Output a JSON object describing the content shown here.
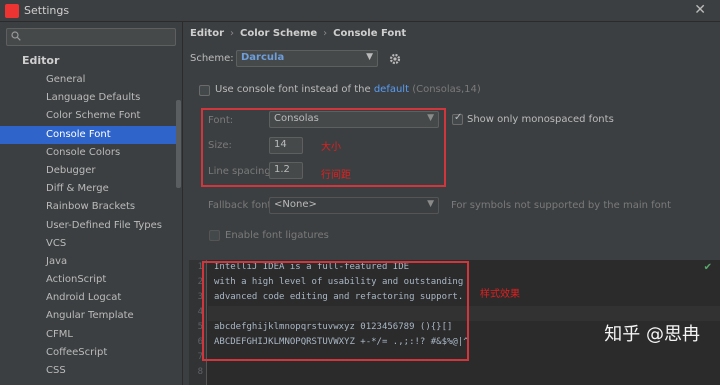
{
  "window": {
    "title": "Settings",
    "close_glyph": "✕"
  },
  "left": {
    "search_placeholder": "",
    "tree_header": "Editor",
    "items": [
      "General",
      "Language Defaults",
      "Color Scheme Font",
      "Console Font",
      "Console Colors",
      "Debugger",
      "Diff & Merge",
      "Rainbow Brackets",
      "User-Defined File Types",
      "VCS",
      "Java",
      "ActionScript",
      "Android Logcat",
      "Angular Template",
      "CFML",
      "CoffeeScript",
      "CSS"
    ],
    "selected_index": 3
  },
  "right": {
    "breadcrumb": [
      "Editor",
      "Color Scheme",
      "Console Font"
    ],
    "scheme_label": "Scheme:",
    "scheme_value": "Darcula",
    "use_console_font": "Use console font instead of the",
    "default_link": "default",
    "default_hint": "(Consolas,14)",
    "font_label": "Font:",
    "font_value": "Consolas",
    "show_mono": "Show only monospaced fonts",
    "size_label": "Size:",
    "size_value": "14",
    "size_annotation": "大小",
    "line_spacing_label": "Line spacing:",
    "line_spacing_value": "1.2",
    "line_spacing_annotation": "行间距",
    "fallback_label": "Fallback font:",
    "fallback_value": "<None>",
    "fallback_hint": "For symbols not supported by the main font",
    "ligatures": "Enable font ligatures",
    "preview_annotation": "样式效果"
  },
  "preview": {
    "lines": [
      "IntelliJ IDEA is a full-featured IDE",
      "with a high level of usability and outstanding",
      "advanced code editing and refactoring support.",
      "",
      "abcdefghijklmnopqrstuvwxyz 0123456789 (){}[]",
      "ABCDEFGHIJKLMNOPQRSTUVWXYZ +-*/= .,;:!? #&$%@|^",
      "",
      ""
    ],
    "line_numbers": [
      "1",
      "2",
      "3",
      "4",
      "5",
      "6",
      "7",
      "8"
    ]
  },
  "watermark": "知乎 @思冉",
  "colors": {
    "accent": "#2f65ca",
    "annotation_red": "#d0363c",
    "link": "#589df6"
  }
}
